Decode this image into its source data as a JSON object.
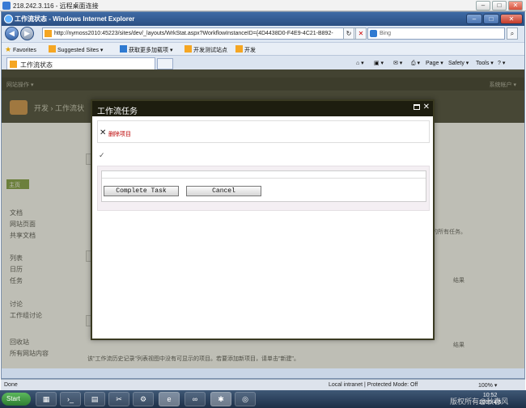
{
  "rdp": {
    "title": "218.242.3.116 - 远程桌面连接"
  },
  "ie": {
    "title": "工作流状态 - Windows Internet Explorer",
    "address": "http://nymoss2010:45223/sites/dev/_layouts/WrkStat.aspx?WorkflowInstanceID={4D4438D0-F4E9-4C21-B892-",
    "search_placeholder": "Bing",
    "favorites_label": "Favorites",
    "fav_items": [
      "Suggested Sites ▾",
      "获取更多加载项 ▾",
      "开发测试站点",
      "开发"
    ],
    "tab_label": "工作流状态",
    "commands": [
      "Page ▾",
      "Safety ▾",
      "Tools ▾"
    ]
  },
  "sharepoint": {
    "site_actions": "网站操作 ▾",
    "user": "系统帐户 ▾",
    "breadcrumb": "开发 › 工作流状",
    "home": "主页",
    "quicklaunch": [
      "文档",
      "网站页面",
      "共享文档",
      "列表",
      "日历",
      "任务",
      "讨论",
      "工作组讨论",
      "回收站",
      "所有网站内容"
    ],
    "body_texts": [
      "的所有任务。",
      "结果",
      "结果"
    ],
    "footer_text": "该\"工作流历史记录\"列表视图中没有可显示的项目。若要添加新项目，请单击\"新建\"。"
  },
  "dialog": {
    "title": "工作流任务",
    "delete_item": "删除项目",
    "complete_button": "Complete Task",
    "cancel_button": "Cancel"
  },
  "status": {
    "left": "Done",
    "zone": "Local intranet | Protected Mode: Off",
    "zoom": "100% ▾"
  },
  "taskbar": {
    "start": "Start",
    "time": "10:52",
    "date": "2010/4/5"
  },
  "watermark": "版权所有@秋春风"
}
